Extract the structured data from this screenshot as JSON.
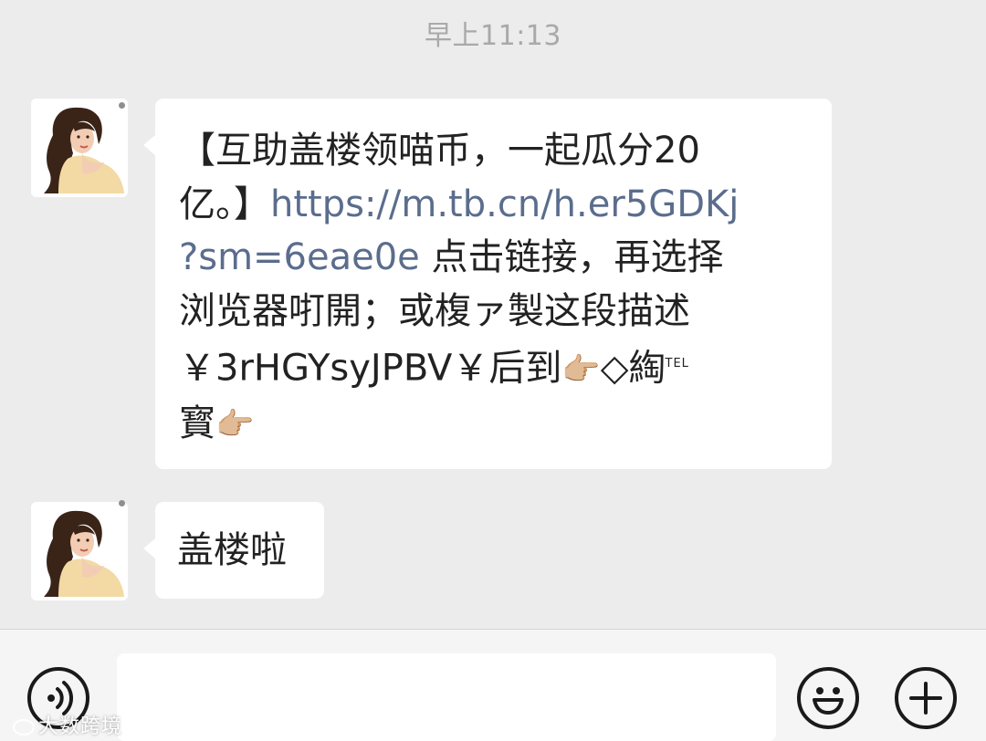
{
  "chat": {
    "timestamp": "早上11:13",
    "messages": [
      {
        "sender": "contact",
        "avatar_icon": "princess-avatar",
        "line1": "【互助盖楼领喵币，一起瓜分20",
        "line2_prefix": "亿。】",
        "link_part1": "https://m.tb.cn/h.er5GDKj",
        "link_part2": "?sm=6eae0e",
        "line3_suffix": " 点击链接，再选择",
        "line4": "浏览器咑開；或椱ァ製这段描述",
        "line5": "￥3rHGYsyJPBV￥后到",
        "pointer_emoji": "👉🏼",
        "diamond": "◇",
        "tao": "綯",
        "tel_mark": "TEL",
        "line6": "寳"
      },
      {
        "sender": "contact",
        "avatar_icon": "princess-avatar",
        "text": "盖楼啦"
      }
    ]
  },
  "input_bar": {
    "voice_icon": "voice-icon",
    "emoji_icon": "smiley-icon",
    "plus_icon": "plus-icon",
    "text_value": ""
  },
  "watermark": {
    "text": "大数跨境"
  }
}
